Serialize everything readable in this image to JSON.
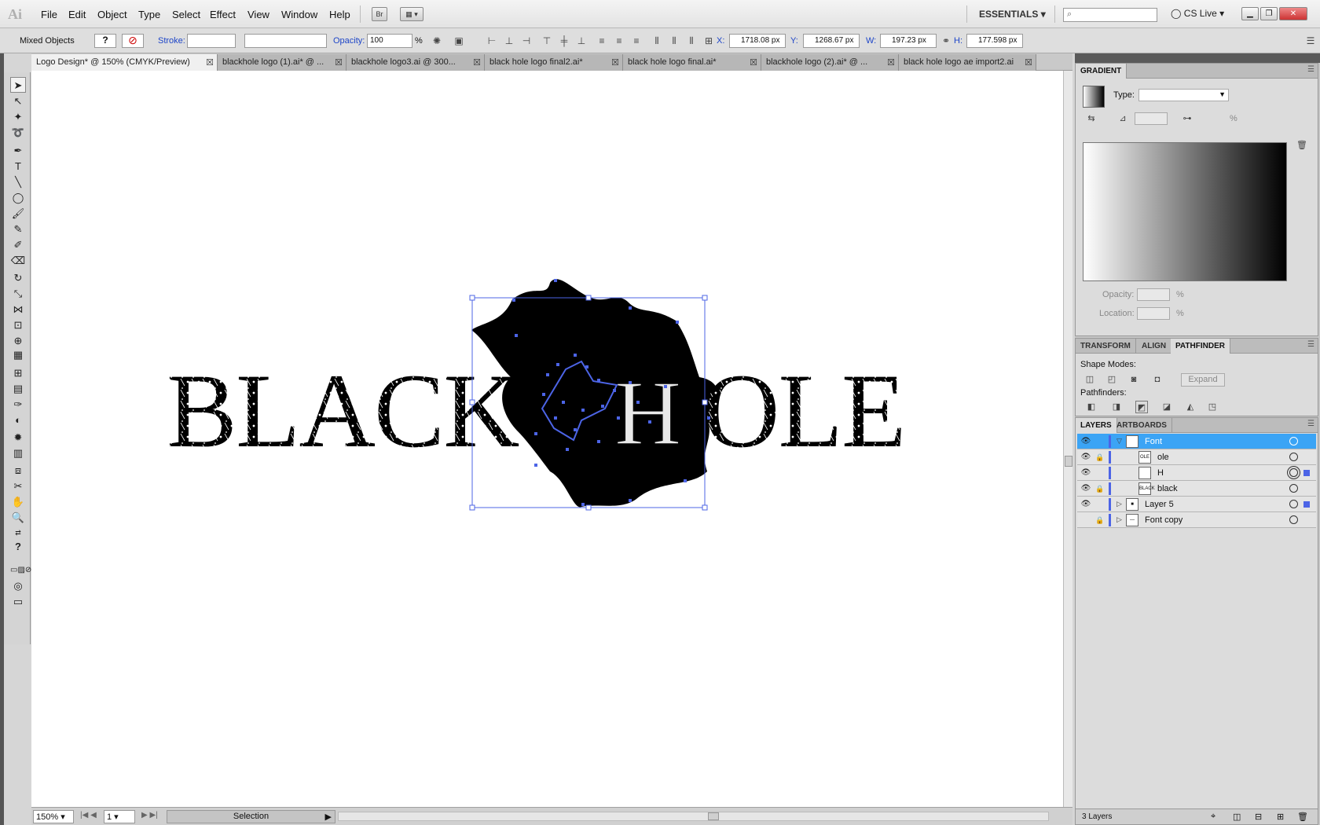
{
  "app": {
    "logo_text": "Ai",
    "menu": [
      "File",
      "Edit",
      "Object",
      "Type",
      "Select",
      "Effect",
      "View",
      "Window",
      "Help"
    ],
    "bridge_label": "Br",
    "workspace": "ESSENTIALS",
    "cs_live": "CS Live"
  },
  "control_bar": {
    "selection_type": "Mixed Objects",
    "fill_label": "?",
    "stroke_label": "Stroke:",
    "opacity_label": "Opacity:",
    "opacity_value": "100",
    "opacity_unit": "%",
    "x_label": "X:",
    "x_value": "1718.08 px",
    "y_label": "Y:",
    "y_value": "1268.67 px",
    "w_label": "W:",
    "w_value": "197.23 px",
    "h_label": "H:",
    "h_value": "177.598 px"
  },
  "tabs": [
    {
      "label": "Logo Design* @ 150% (CMYK/Preview)",
      "active": true
    },
    {
      "label": "blackhole logo (1).ai* @ ...",
      "active": false
    },
    {
      "label": "blackhole logo3.ai @ 300...",
      "active": false
    },
    {
      "label": "black hole logo final2.ai*",
      "active": false
    },
    {
      "label": "black hole logo final.ai*",
      "active": false
    },
    {
      "label": "blackhole logo (2).ai* @ ...",
      "active": false
    },
    {
      "label": "black hole logo ae import2.ai",
      "active": false
    }
  ],
  "artwork": {
    "text_left": "BLACK",
    "text_mid": "H",
    "text_right": "OLE"
  },
  "status_bar": {
    "zoom": "150%",
    "artboard": "1",
    "tool_status": "Selection"
  },
  "gradient_panel": {
    "title": "GRADIENT",
    "type_label": "Type:",
    "type_value": "",
    "percent": "%",
    "opacity_label": "Opacity:",
    "location_label": "Location:"
  },
  "transform_panel": {
    "tabs": [
      "TRANSFORM",
      "ALIGN",
      "PATHFINDER"
    ],
    "active_tab": "PATHFINDER",
    "shape_modes_label": "Shape Modes:",
    "expand_label": "Expand",
    "pathfinders_label": "Pathfinders:"
  },
  "layers_panel": {
    "tabs": [
      "LAYERS",
      "ARTBOARDS"
    ],
    "active_tab": "LAYERS",
    "rows": [
      {
        "name": "Font",
        "thumb": "—",
        "selected": true,
        "expanded": true,
        "indent": 0,
        "locked": false
      },
      {
        "name": "ole",
        "thumb": "OLE",
        "selected": false,
        "expanded": false,
        "indent": 1,
        "locked": true
      },
      {
        "name": "H",
        "thumb": "",
        "selected": false,
        "expanded": false,
        "indent": 1,
        "locked": false
      },
      {
        "name": "black",
        "thumb": "BLACK",
        "selected": false,
        "expanded": false,
        "indent": 1,
        "locked": true
      },
      {
        "name": "Layer 5",
        "thumb": "■",
        "selected": false,
        "expanded": false,
        "indent": 0,
        "locked": false
      },
      {
        "name": "Font copy",
        "thumb": "—",
        "selected": false,
        "expanded": false,
        "indent": 0,
        "locked": true
      }
    ],
    "footer": "3 Layers"
  },
  "colors": {
    "selection_blue": "#4c64e6",
    "layer_selected": "#3ba4f5"
  }
}
